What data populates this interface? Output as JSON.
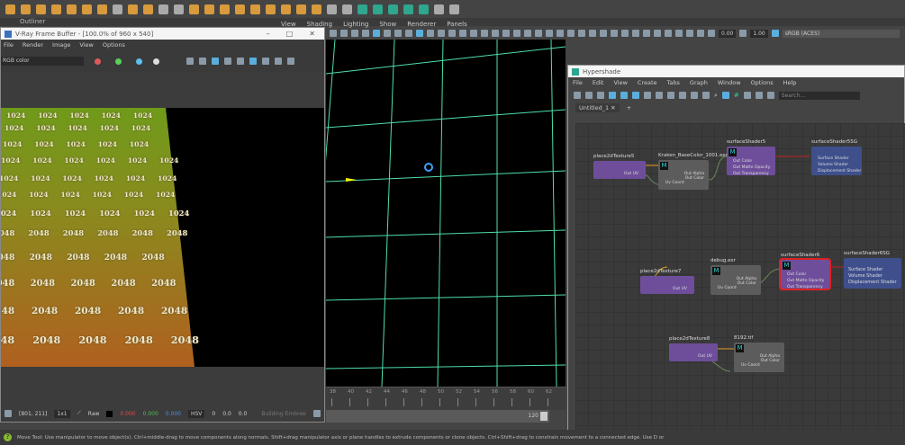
{
  "maya": {
    "outliner_label": "Outliner",
    "viewport_menu": [
      "View",
      "Shading",
      "Lighting",
      "Show",
      "Renderer",
      "Panels"
    ],
    "exposure": "0.00",
    "gamma": "1.00",
    "color_space": "sRGB (ACES)",
    "timeline_ticks": [
      "38",
      "40",
      "42",
      "44",
      "46",
      "48",
      "50",
      "52",
      "54",
      "56",
      "58",
      "60",
      "62"
    ],
    "range_end": "120",
    "help_text": "Move Tool: Use manipulator to move object(s). Ctrl+middle-drag to move components along normals. Shift+drag manipulator axis or plane handles to extrude components or clone objects. Ctrl+Shift+drag to constrain movement to a connected edge. Use D or"
  },
  "vfb": {
    "title": "V-Ray Frame Buffer - [100.0% of 960 x 540]",
    "menu": [
      "File",
      "Render",
      "Image",
      "View",
      "Options"
    ],
    "channel": "RGB color",
    "render_texts": {
      "small": "1024",
      "large": "2048"
    },
    "status": {
      "coords": "[801, 211]",
      "zoom": "1x1",
      "raw_label": "Raw",
      "r": "0.000",
      "g": "0.000",
      "b": "0.000",
      "mode": "HSV",
      "h": "0",
      "s": "0.0",
      "v": "0.0",
      "building": "Building Embree"
    }
  },
  "hypershade": {
    "title": "Hypershade",
    "menu": [
      "File",
      "Edit",
      "View",
      "Create",
      "Tabs",
      "Graph",
      "Window",
      "Options",
      "Help"
    ],
    "search_placeholder": "Search...",
    "tab": "Untitled_1",
    "nodes": {
      "place5": {
        "name": "place2dTexture5",
        "out": "Out UV"
      },
      "file1": {
        "name": "Kraken_BaseColor_1001.exr",
        "alpha": "Out Alpha",
        "color": "Out Color",
        "uv": "Uv Coord"
      },
      "ss5": {
        "name": "surfaceShader5",
        "rows": [
          "Out Color",
          "Out Matte Opacity",
          "Out Transparency"
        ]
      },
      "sg5": {
        "name": "surfaceShader5SG",
        "rows": [
          "Surface Shader",
          "Volume Shader",
          "Displacement Shader"
        ]
      },
      "place7": {
        "name": "place2dTexture7",
        "out": "Out UV"
      },
      "file2": {
        "name": "debug.exr",
        "alpha": "Out Alpha",
        "color": "Out Color",
        "uv": "Uv Coord"
      },
      "ss6": {
        "name": "surfaceShader6",
        "rows": [
          "Out Color",
          "Out Matte Opacity",
          "Out Transparency"
        ]
      },
      "sg6": {
        "name": "surfaceShader6SG",
        "rows": [
          "Surface Shader",
          "Volume Shader",
          "Displacement Shader"
        ]
      },
      "place8": {
        "name": "place2dTexture8",
        "out": "Out UV"
      },
      "file3": {
        "name": "8192.tif",
        "alpha": "Out Alpha",
        "color": "Out Color",
        "uv": "Uv Coord"
      }
    }
  },
  "colors": {
    "accent": "#2fa68e",
    "selected": "#dd2222"
  }
}
